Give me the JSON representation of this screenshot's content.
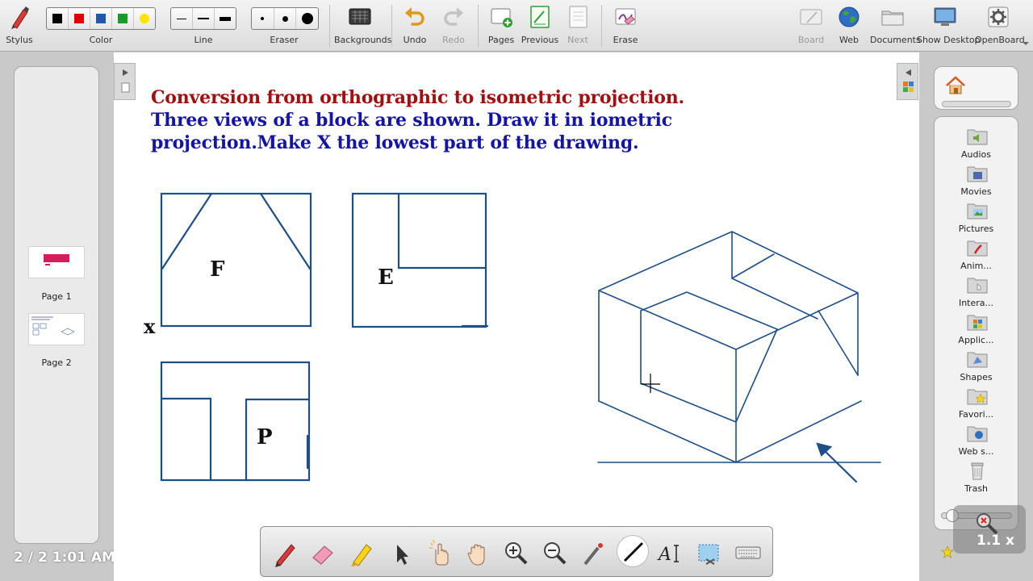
{
  "toolbar": {
    "stylus": "Stylus",
    "color": "Color",
    "line": "Line",
    "eraser": "Eraser",
    "backgrounds": "Backgrounds",
    "undo": "Undo",
    "redo": "Redo",
    "pages": "Pages",
    "previous": "Previous",
    "next": "Next",
    "erase": "Erase",
    "board": "Board",
    "web": "Web",
    "documents": "Documents",
    "show_desktop": "Show Desktop",
    "openboard": "OpenBoard",
    "palette_colors": [
      "#000000",
      "#e00000",
      "#1f5aa6",
      "#1a9a2a",
      "#ffe400"
    ]
  },
  "pages_panel": {
    "pages": [
      {
        "label": "Page 1"
      },
      {
        "label": "Page 2"
      }
    ],
    "clock": "2 / 2 1:01 AM"
  },
  "board": {
    "title_line1": "Conversion from orthographic to isometric projection.",
    "title_line2": "Three views of a block are shown. Draw it in iometric",
    "title_line3": "projection.Make X the lowest part of the drawing.",
    "title_color": "#a01010",
    "subtitle_color": "#1414a8",
    "view_labels": {
      "front": "F",
      "end": "E",
      "plan": "P",
      "x_mark": "x"
    },
    "drawing_color": "#1d4e86"
  },
  "library": {
    "items": [
      {
        "label": "Audios",
        "icon": "audio-folder-icon"
      },
      {
        "label": "Movies",
        "icon": "movie-folder-icon"
      },
      {
        "label": "Pictures",
        "icon": "picture-folder-icon"
      },
      {
        "label": "Anim...",
        "icon": "animation-folder-icon"
      },
      {
        "label": "Intera...",
        "icon": "interactive-folder-icon"
      },
      {
        "label": "Applic...",
        "icon": "application-folder-icon"
      },
      {
        "label": "Shapes",
        "icon": "shapes-folder-icon"
      },
      {
        "label": "Favori...",
        "icon": "favorites-folder-icon"
      },
      {
        "label": "Web s...",
        "icon": "web-folder-icon"
      },
      {
        "label": "Trash",
        "icon": "trash-icon"
      }
    ]
  },
  "zoom": {
    "label": "1.1 x"
  }
}
